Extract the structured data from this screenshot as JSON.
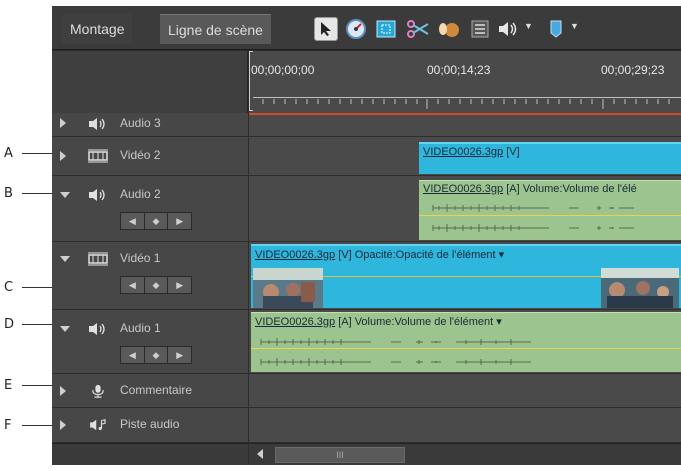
{
  "callouts": [
    "A",
    "B",
    "C",
    "D",
    "E",
    "F"
  ],
  "tabs": {
    "montage": "Montage",
    "scene": "Ligne de scène"
  },
  "toolbar": {
    "icons": [
      "selection-tool-icon",
      "time-stretch-icon",
      "crop-tool-icon",
      "scissors-icon",
      "audio-mix-icon",
      "list-icon",
      "volume-icon",
      "marker-icon"
    ]
  },
  "ruler": {
    "timecodes": [
      "00;00;00;00",
      "00;00;14;23",
      "00;00;29;23"
    ]
  },
  "tracks": [
    {
      "name": "Audio 3",
      "type": "audio"
    },
    {
      "name": "Vidéo 2",
      "type": "video"
    },
    {
      "name": "Audio 2",
      "type": "audio"
    },
    {
      "name": "Vidéo 1",
      "type": "video"
    },
    {
      "name": "Audio 1",
      "type": "audio"
    },
    {
      "name": "Commentaire",
      "type": "narration"
    },
    {
      "name": "Piste audio",
      "type": "soundtrack"
    }
  ],
  "clips": {
    "video2": {
      "file": "VIDEO0026.3gp",
      "tag": "[V]"
    },
    "audio2": {
      "file": "VIDEO0026.3gp",
      "tag": "[A]",
      "effect": "Volume:Volume de l'élé"
    },
    "video1": {
      "file": "VIDEO0026.3gp",
      "tag": "[V]",
      "effect": "Opacité:Opacité de l'élément ▾"
    },
    "audio1": {
      "file": "VIDEO0026.3gp",
      "tag": "[A]",
      "effect": "Volume:Volume de l'élément ▾"
    }
  },
  "keyframe_nav": {
    "prev": "◀",
    "add": "◆",
    "next": "▶"
  },
  "scroll": {
    "grip": "III"
  },
  "colors": {
    "video_clip": "#2fb6dc",
    "audio_clip": "#9cc48e",
    "volume_line": "#f0d050",
    "ruler_line": "#d24a2a"
  }
}
